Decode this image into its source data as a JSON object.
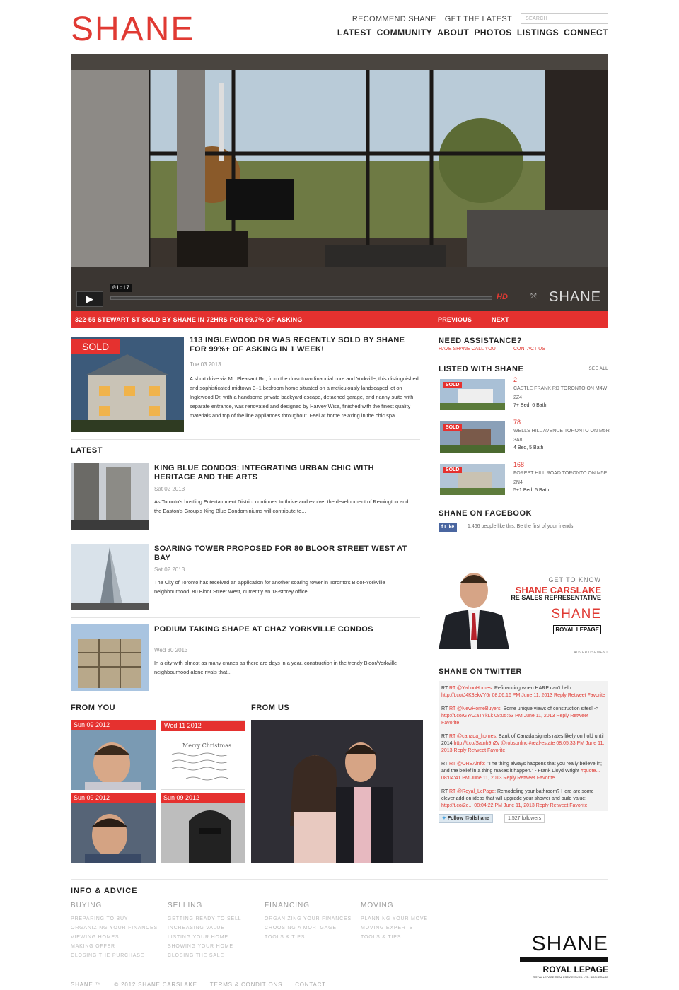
{
  "header": {
    "logo": "SHANE",
    "toplinks": [
      "RECOMMEND SHANE",
      "GET THE LATEST"
    ],
    "search_placeholder": "SEARCH",
    "nav": [
      "LATEST",
      "COMMUNITY",
      "ABOUT",
      "PHOTOS",
      "LISTINGS",
      "CONNECT"
    ]
  },
  "hero": {
    "time": "01:17",
    "hd": "HD",
    "brand": "SHANE",
    "ticker": "322-55 STEWART ST SOLD BY SHANE IN 72HRS FOR 99.7% OF ASKING",
    "prev": "PREVIOUS",
    "next": "NEXT"
  },
  "featured": {
    "badge": "SOLD",
    "title": "113 INGLEWOOD DR WAS RECENTLY SOLD BY SHANE FOR 99%+ OF ASKING IN 1 WEEK!",
    "date": "Tue 03 2013",
    "text": "A short drive via Mt. Pleasant Rd, from the downtown financial core and Yorkville, this distinguished and sophisticated midtown 3+1 bedroom home situated on a meticulously landscaped lot on Inglewood Dr, with a handsome private backyard escape, detached garage, and nanny suite with separate entrance, was renovated and designed by Harvey Wise, finished with the finest quality materials and top of the line appliances throughout. Feel at home relaxing in the chic spa..."
  },
  "latest": {
    "heading": "LATEST",
    "articles": [
      {
        "title": "KING BLUE CONDOS: INTEGRATING URBAN CHIC WITH HERITAGE AND THE ARTS",
        "date": "Sat 02 2013",
        "text": "As Toronto's bustling Entertainment District continues to thrive and evolve, the development of Remington and the Easton's Group's King Blue Condominiums will contribute to..."
      },
      {
        "title": "SOARING TOWER PROPOSED FOR 80 BLOOR STREET WEST AT BAY",
        "date": "Sat 02 2013",
        "text": "The City of Toronto has received an application for another soaring tower in Toronto's Bloor-Yorkville neighbourhood. 80 Bloor Street West, currently an 18-storey office..."
      },
      {
        "title": "PODIUM TAKING SHAPE AT CHAZ YORKVILLE CONDOS",
        "date": "Wed 30 2013",
        "text": "In a city with almost as many cranes as there are days in a year, construction in the trendy Bloor/Yorkville neighbourhood alone rivals that..."
      }
    ]
  },
  "from_you": {
    "heading": "FROM YOU",
    "dates": [
      "Sun 09 2012",
      "Wed 11 2012",
      "Sun 09 2012",
      "Sun 09 2012"
    ],
    "card_text": "Merry Christmas"
  },
  "from_us": {
    "heading": "FROM US"
  },
  "sidebar": {
    "assist": {
      "heading": "NEED ASSISTANCE?",
      "links": [
        "HAVE SHANE CALL YOU",
        "CONTACT US"
      ]
    },
    "listed": {
      "heading": "LISTED WITH SHANE",
      "see_all": "SEE ALL",
      "badge": "SOLD",
      "items": [
        {
          "num": "2",
          "addr": "CASTLE FRANK RD TORONTO ON M4W 2Z4",
          "bb": "7+ Bed, 6 Bath"
        },
        {
          "num": "78",
          "addr": "WELLS HILL AVENUE TORONTO ON M5R 3A8",
          "bb": "4 Bed, 5 Bath"
        },
        {
          "num": "168",
          "addr": "FOREST HILL ROAD TORONTO ON M5P 2N4",
          "bb": "5+1 Bed, 5 Bath"
        }
      ]
    },
    "facebook": {
      "heading": "SHANE ON FACEBOOK",
      "like": "Like",
      "text": "1,466 people like this. Be the first of your friends."
    },
    "ad": {
      "get": "GET TO KNOW",
      "name": "SHANE CARSLAKE",
      "role": "RE SALES REPRESENTATIVE",
      "brand": "SHANE",
      "rl": "ROYAL LEPAGE",
      "label": "ADVERTISEMENT"
    },
    "twitter": {
      "heading": "SHANE ON TWITTER",
      "follow": "Follow @allshane",
      "followers": "1,527 followers",
      "tweets": [
        {
          "a": "RT @YahooHomes:",
          "b": " Refinancing when HARP can't help ",
          "c": "http://t.co/J4K3ekVY6r 08:06:16 PM June 11, 2013 Reply Retweet Favorite"
        },
        {
          "a": "RT @NewHomeBuyers:",
          "b": " Some unique views of construction sites! -> ",
          "c": "http://t.co/GYAZaTYkLk 08:05:53 PM June 11, 2013 Reply Retweet Favorite"
        },
        {
          "a": "RT @canada_homes:",
          "b": " Bank of Canada signals rates likely on hold until 2014 ",
          "c": "http://t.co/Satnh9hZv @robsonlnc #real-estate 08:05:33 PM June 11, 2013 Reply Retweet Favorite"
        },
        {
          "a": "RT @OREAinfo:",
          "b": " \"The thing always happens that you really believe in; and the belief in a thing makes it happen.\" - Frank Lloyd Wright ",
          "c": "#quote... 08:04:41 PM June 11, 2013 Reply Retweet Favorite"
        },
        {
          "a": "RT @Royal_LePage:",
          "b": " Remodeling your bathroom? Here are some clever add-on ideas that will upgrade your shower and build value: ",
          "c": "http://t.co/2e... 08:04:22 PM June 11, 2013 Reply Retweet Favorite"
        }
      ]
    }
  },
  "footer": {
    "heading": "INFO & ADVICE",
    "cols": [
      {
        "h": "BUYING",
        "items": [
          "PREPARING TO BUY",
          "ORGANIZING YOUR FINANCES",
          "VIEWING HOMES",
          "MAKING OFFER",
          "CLOSING THE PURCHASE"
        ]
      },
      {
        "h": "SELLING",
        "items": [
          "GETTING READY TO SELL",
          "INCREASING VALUE",
          "LISTING YOUR HOME",
          "SHOWING YOUR HOME",
          "CLOSING THE SALE"
        ]
      },
      {
        "h": "FINANCING",
        "items": [
          "ORGANIZING YOUR FINANCES",
          "CHOOSING A MORTGAGE",
          "TOOLS & TIPS"
        ]
      },
      {
        "h": "MOVING",
        "items": [
          "PLANNING YOUR MOVE",
          "MOVING EXPERTS",
          "TOOLS & TIPS"
        ]
      }
    ],
    "copy": [
      "SHANE ™",
      "© 2012 SHANE CARSLAKE",
      "TERMS & CONDITIONS",
      "CONTACT"
    ],
    "logo": "SHANE",
    "rl": "ROYAL LEPAGE",
    "rl_sub": "ROYAL LEPAGE REAL ESTATE SVCS. LTD. BROKERAGE"
  }
}
